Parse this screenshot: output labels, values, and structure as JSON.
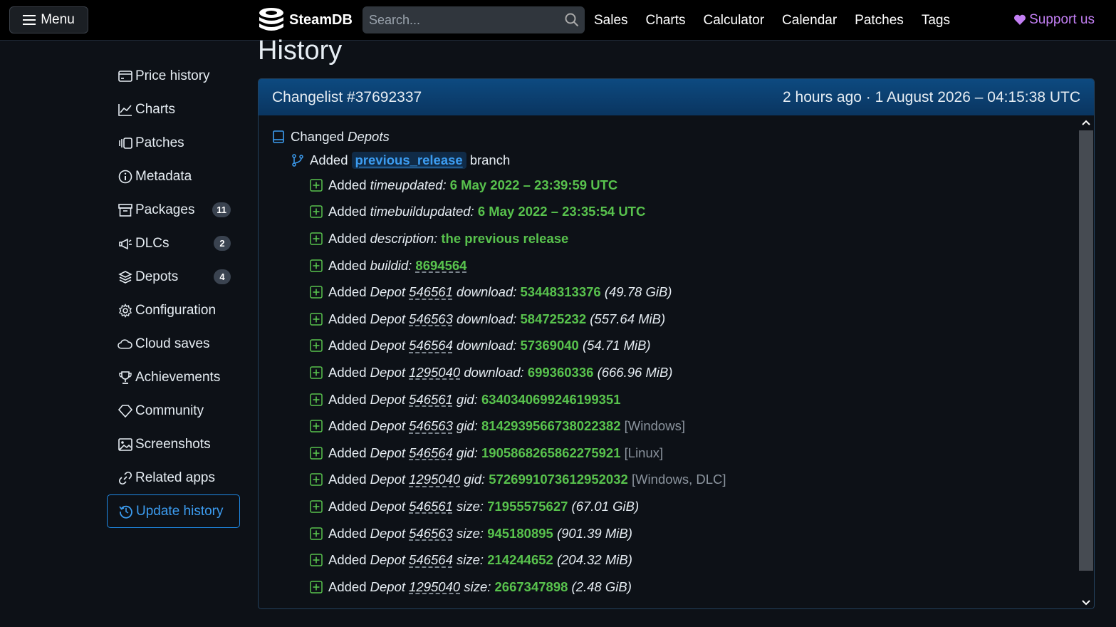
{
  "topbar": {
    "menu_label": "Menu",
    "logo_text": "SteamDB",
    "search_placeholder": "Search...",
    "nav": [
      "Sales",
      "Charts",
      "Calculator",
      "Calendar",
      "Patches",
      "Tags"
    ],
    "support_label": "Support us"
  },
  "sidebar": {
    "items": [
      {
        "label": "Price history",
        "icon": "price-history-icon"
      },
      {
        "label": "Charts",
        "icon": "chart-icon"
      },
      {
        "label": "Patches",
        "icon": "patches-icon"
      },
      {
        "label": "Metadata",
        "icon": "info-icon"
      },
      {
        "label": "Packages",
        "icon": "package-icon",
        "badge": "11"
      },
      {
        "label": "DLCs",
        "icon": "dlc-icon",
        "badge": "2"
      },
      {
        "label": "Depots",
        "icon": "layers-icon",
        "badge": "4"
      },
      {
        "label": "Configuration",
        "icon": "gear-icon"
      },
      {
        "label": "Cloud saves",
        "icon": "cloud-icon"
      },
      {
        "label": "Achievements",
        "icon": "trophy-icon"
      },
      {
        "label": "Community",
        "icon": "tag-icon"
      },
      {
        "label": "Screenshots",
        "icon": "image-icon"
      },
      {
        "label": "Related apps",
        "icon": "link-icon"
      },
      {
        "label": "Update history",
        "icon": "history-icon",
        "active": true
      }
    ]
  },
  "page_title": "History",
  "changelist": {
    "title": "Changelist #37692337",
    "time": "2 hours ago · 1 August 2026 – 04:15:38 UTC",
    "changed_label": "Changed",
    "changed_object": "Depots",
    "branch_added": "Added",
    "branch_name": "previous_release",
    "branch_word": "branch",
    "added_word": "Added",
    "depot_word": "Depot",
    "entries": [
      {
        "key": "timeupdated:",
        "value": "6 May 2022 – 23:39:59 UTC"
      },
      {
        "key": "timebuildupdated:",
        "value": "6 May 2022 – 23:35:54 UTC"
      },
      {
        "key": "description:",
        "value": "the previous release"
      },
      {
        "key": "buildid:",
        "value": "8694564"
      }
    ],
    "depot_entries": [
      {
        "depot": "546561",
        "field": "download:",
        "value": "53448313376",
        "extra": "(49.78 GiB)"
      },
      {
        "depot": "546563",
        "field": "download:",
        "value": "584725232",
        "extra": "(557.64 MiB)"
      },
      {
        "depot": "546564",
        "field": "download:",
        "value": "57369040",
        "extra": "(54.71 MiB)"
      },
      {
        "depot": "1295040",
        "field": "download:",
        "value": "699360336",
        "extra": "(666.96 MiB)"
      },
      {
        "depot": "546561",
        "field": "gid:",
        "value": "6340340699246199351",
        "tag": ""
      },
      {
        "depot": "546563",
        "field": "gid:",
        "value": "8142939566738022382",
        "tag": "[Windows]"
      },
      {
        "depot": "546564",
        "field": "gid:",
        "value": "1905868265862275921",
        "tag": "[Linux]"
      },
      {
        "depot": "1295040",
        "field": "gid:",
        "value": "5726991073612952032",
        "tag": "[Windows, DLC]"
      },
      {
        "depot": "546561",
        "field": "size:",
        "value": "71955575627",
        "extra": "(67.01 GiB)"
      },
      {
        "depot": "546563",
        "field": "size:",
        "value": "945180895",
        "extra": "(901.39 MiB)"
      },
      {
        "depot": "546564",
        "field": "size:",
        "value": "214244652",
        "extra": "(204.32 MiB)"
      },
      {
        "depot": "1295040",
        "field": "size:",
        "value": "2667347898",
        "extra": "(2.48 GiB)"
      }
    ]
  },
  "colors": {
    "accent": "#3c9cf0",
    "green": "#58c24d",
    "support": "#c37ff4",
    "header": "#0d4a80"
  }
}
